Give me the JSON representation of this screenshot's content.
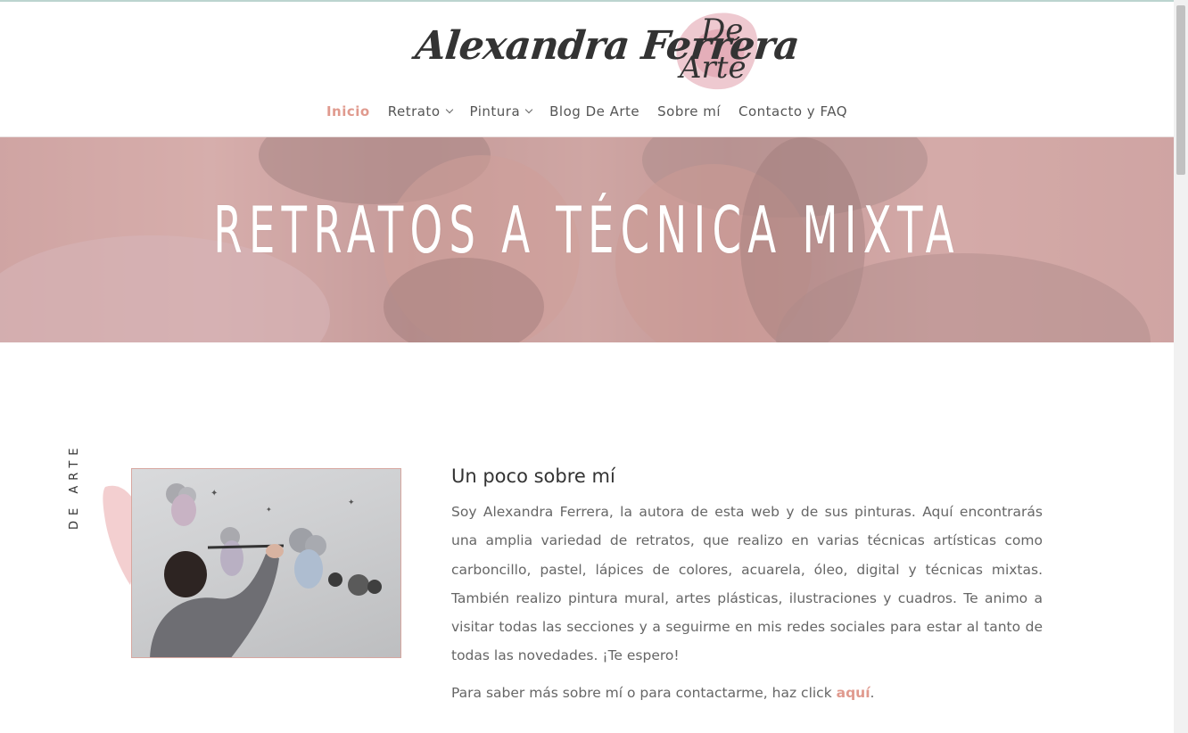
{
  "site": {
    "logo_text": "Alexandra Ferrera",
    "logo_de": "De",
    "logo_arte": "Arte"
  },
  "nav": {
    "items": [
      {
        "label": "Inicio",
        "active": true,
        "dropdown": false
      },
      {
        "label": "Retrato",
        "active": false,
        "dropdown": true
      },
      {
        "label": "Pintura",
        "active": false,
        "dropdown": true
      },
      {
        "label": "Blog De Arte",
        "active": false,
        "dropdown": false
      },
      {
        "label": "Sobre mí",
        "active": false,
        "dropdown": false
      },
      {
        "label": "Contacto y FAQ",
        "active": false,
        "dropdown": false
      }
    ]
  },
  "hero": {
    "title": "RETRATOS A TÉCNICA MIXTA"
  },
  "side_label": "DE ARTE",
  "about": {
    "title": "Un poco sobre mí",
    "body": "Soy Alexandra Ferrera, la autora de esta web y de sus pinturas. Aquí encontrarás una amplia variedad de retratos, que realizo en varias técnicas artísticas como carboncillo, pastel, lápices de colores, acuarela, óleo, digital y técnicas mixtas. También realizo pintura mural, artes plásticas, ilustraciones y cuadros. Te animo a visitar todas las secciones y a seguirme en mis redes sociales para estar al tanto de todas las novedades. ¡Te espero!",
    "contact_prefix": "Para saber más sobre mí o para contactarme, haz click ",
    "contact_link": "aquí",
    "contact_suffix": "."
  },
  "colors": {
    "accent": "#e09a8e",
    "text": "#666666",
    "heading": "#333333"
  }
}
